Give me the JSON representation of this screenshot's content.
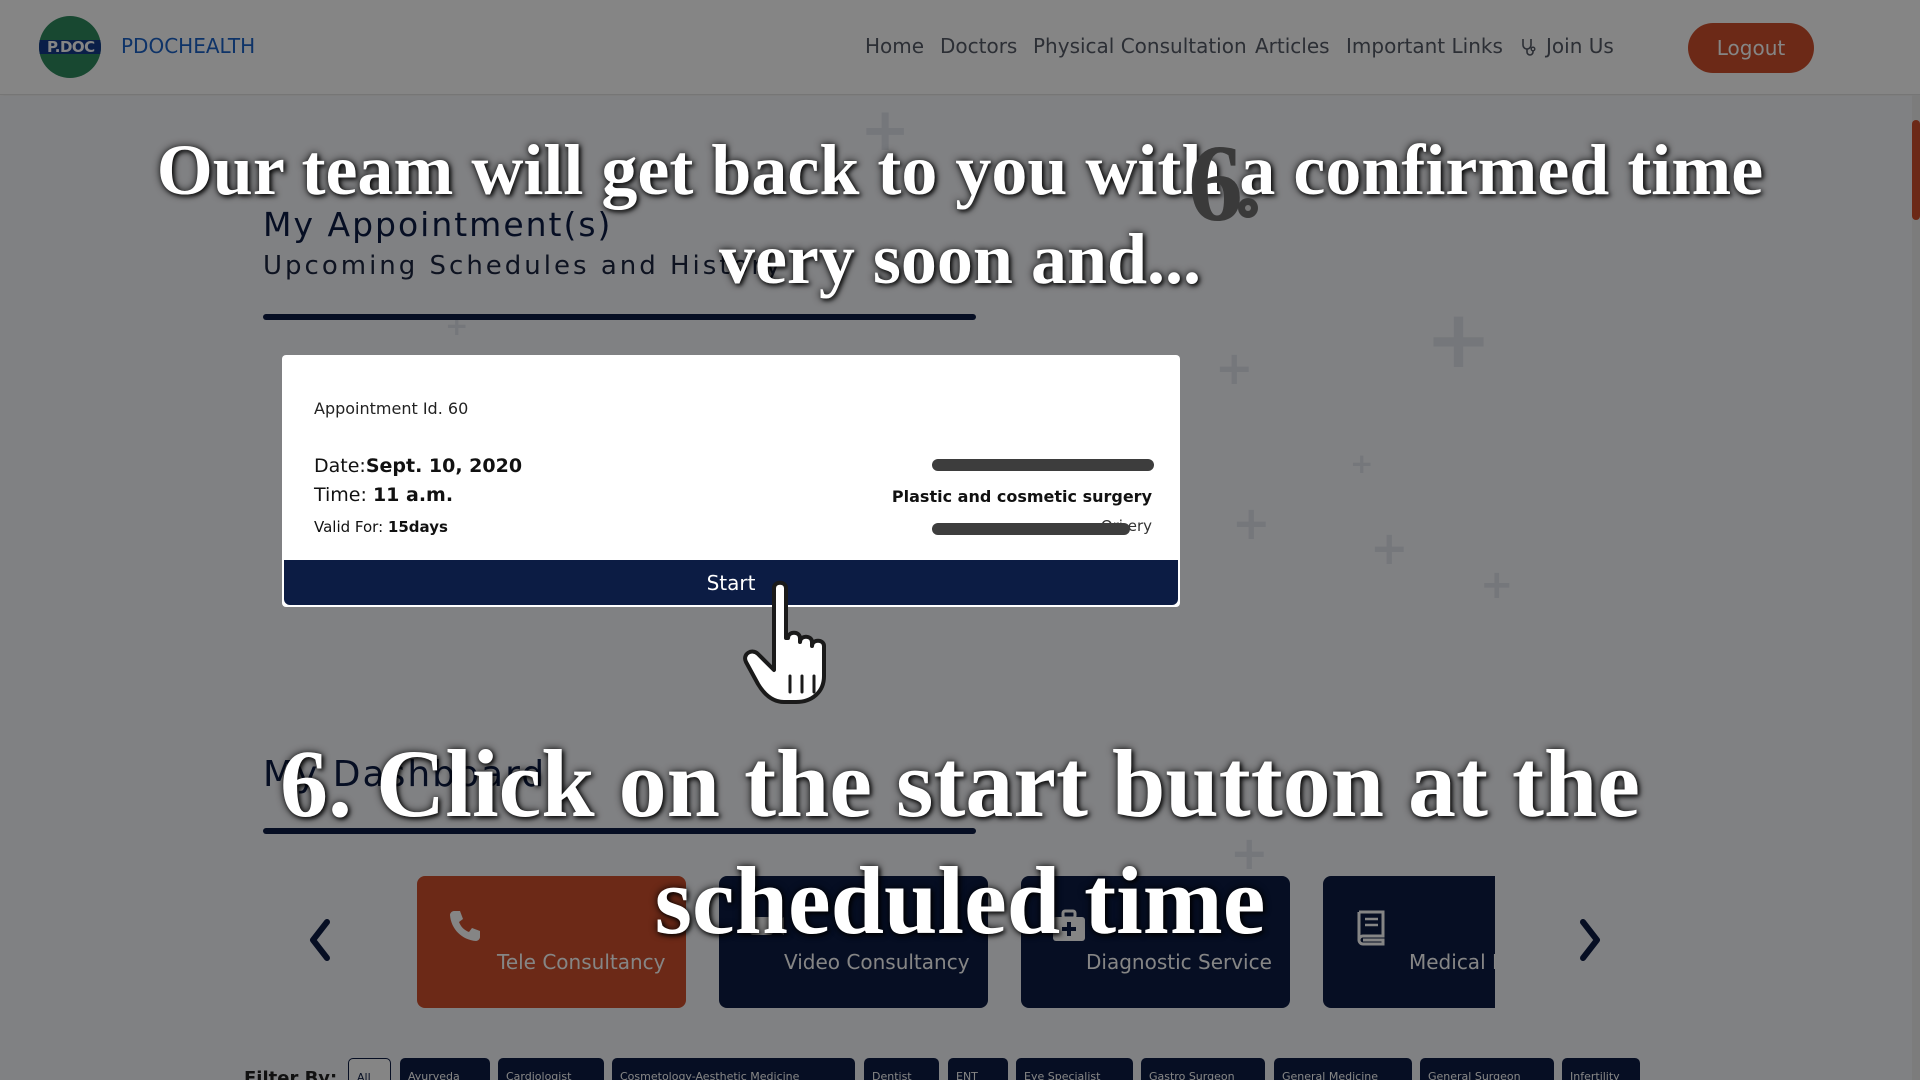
{
  "navbar": {
    "brand": "PDOCHEALTH",
    "logo_text": "P.DOC",
    "links": [
      "Home",
      "Doctors",
      "Physical Consultation",
      "Articles",
      "Important Links",
      "Join Us"
    ],
    "logout_label": "Logout",
    "icons": {
      "join": "stethoscope-icon"
    }
  },
  "appointments": {
    "title": "My Appointment(s)",
    "subtitle": "Upcoming Schedules and History"
  },
  "card": {
    "appointment_id": "Appointment Id. 60",
    "date_label": "Date:",
    "date_value": "Sept. 10, 2020",
    "time_label": "Time: ",
    "time_value": "11 a.m.",
    "valid_label": "Valid For: ",
    "valid_value": "15days",
    "specialty": "Plastic and cosmetic surgery",
    "qualification_visible": "Ori                                     ery",
    "start_label": "Start"
  },
  "dashboard": {
    "title": "My Dashboard",
    "services": [
      {
        "label": "Tele Consultancy",
        "icon": "phone-icon"
      },
      {
        "label": "Video Consultancy",
        "icon": "video-icon"
      },
      {
        "label": "Diagnostic Service",
        "icon": "medical-kit-icon"
      },
      {
        "label": "Medical R",
        "icon": "book-icon"
      }
    ]
  },
  "filters": {
    "label": "Filter By:",
    "chips": [
      "All",
      "Ayurveda",
      "Cardiologist",
      "Cosmetology-Aesthetic Medicine",
      "Dentist",
      "ENT",
      "Eye Specialist",
      "Gastro Surgeon",
      "General Medicine",
      "General Surgeon",
      "Infertility"
    ]
  },
  "overlay": {
    "top_caption": [
      "Our team will get back to you with a confirmed time",
      "very soon and..."
    ],
    "bottom_caption": [
      "6. Click on the start button at the",
      "scheduled time"
    ],
    "badge_number": "6"
  },
  "colors": {
    "navy": "#0c1c44",
    "accent": "#d0502c",
    "brand_blue": "#1b63c8"
  }
}
